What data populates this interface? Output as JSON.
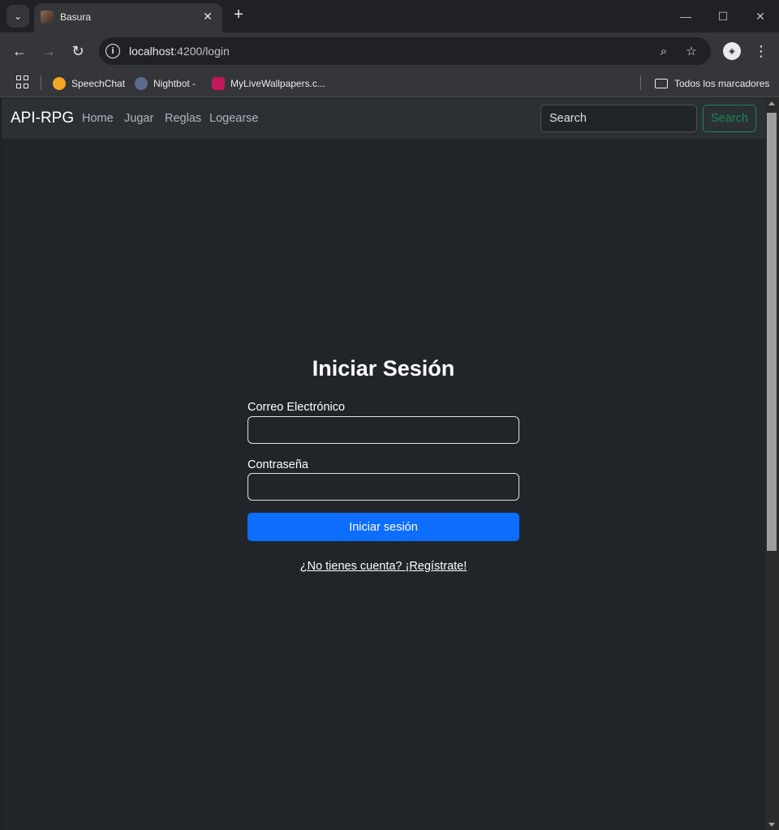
{
  "browser": {
    "tab_title": "Basura",
    "url_host": "localhost",
    "url_path": ":4200/login",
    "bookmarks": [
      {
        "label": "SpeechChat",
        "color": "#f5a623"
      },
      {
        "label": "Nightbot -",
        "color": "#5b6b8c"
      },
      {
        "label": "MyLiveWallpapers.c...",
        "color": "#c2185b"
      }
    ],
    "bookmarks_folder": "Todos los marcadores"
  },
  "navbar": {
    "brand": "API-RPG",
    "links": [
      "Home",
      "Jugar",
      "Reglas",
      "Logearse"
    ],
    "search_placeholder": "Search",
    "search_button": "Search"
  },
  "login": {
    "title": "Iniciar Sesión",
    "email_label": "Correo Electrónico",
    "email_value": "",
    "password_label": "Contraseña",
    "password_value": "",
    "submit_label": "Iniciar sesión",
    "register_link": "¿No tienes cuenta? ¡Regístrate!"
  },
  "colors": {
    "accent_primary": "#0d6efd",
    "accent_success": "#198754",
    "page_bg": "#212529",
    "navbar_bg": "#2b3035"
  }
}
